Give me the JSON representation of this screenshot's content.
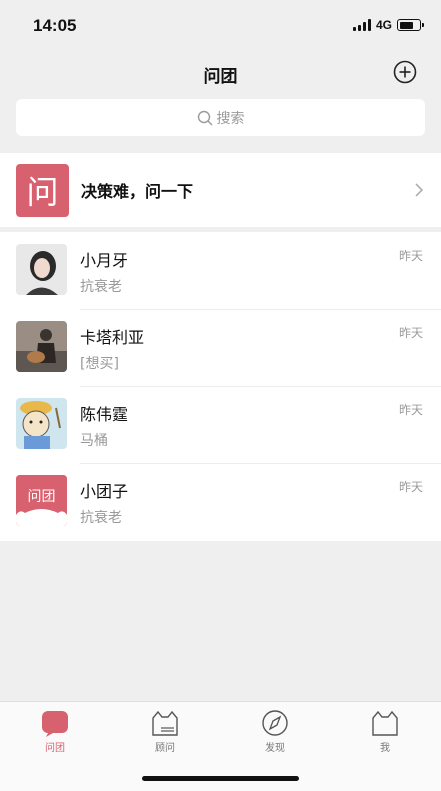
{
  "status_bar": {
    "time": "14:05",
    "network": "4G"
  },
  "nav": {
    "title": "问团",
    "add_icon": "plus-circle-icon"
  },
  "search": {
    "placeholder": "搜索"
  },
  "banner": {
    "logo_char": "问",
    "text": "决策难，问一下"
  },
  "chats": [
    {
      "name": "小月牙",
      "preview": "抗衰老",
      "time": "昨天",
      "avatar": "portrait-photo"
    },
    {
      "name": "卡塔利亚",
      "preview": "[想买]",
      "time": "昨天",
      "avatar": "guitar-photo"
    },
    {
      "name": "陈伟霆",
      "preview": "马桶",
      "time": "昨天",
      "avatar": "cartoon-photo"
    },
    {
      "name": "小团子",
      "preview": "抗衰老",
      "time": "昨天",
      "avatar": "wentuan-logo",
      "avatar_text": "问团"
    }
  ],
  "tabs": [
    {
      "label": "问团",
      "active": true
    },
    {
      "label": "顾问",
      "active": false
    },
    {
      "label": "发现",
      "active": false
    },
    {
      "label": "我",
      "active": false
    }
  ],
  "colors": {
    "accent": "#d8616f",
    "background": "#efefef"
  }
}
